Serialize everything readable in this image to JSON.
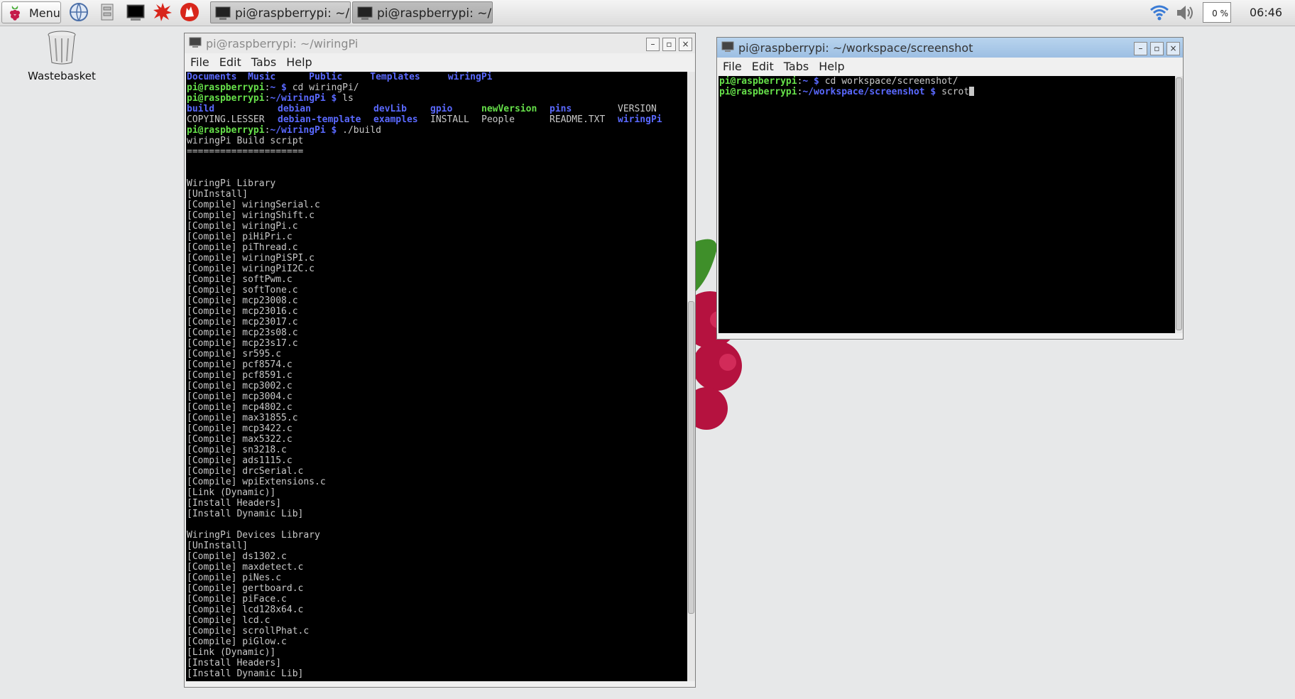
{
  "taskbar": {
    "menu_label": "Menu",
    "tasks": [
      {
        "label": "pi@raspberrypi: ~/wir..."
      },
      {
        "label": "pi@raspberrypi: ~/wo..."
      }
    ],
    "cpu": "0 %",
    "clock": "06:46"
  },
  "desktop": {
    "wastebasket_label": "Wastebasket"
  },
  "win1": {
    "title": "pi@raspberrypi: ~/wiringPi",
    "menu": [
      "File",
      "Edit",
      "Tabs",
      "Help"
    ],
    "dirs_line": "Documents  Music      Public     Templates     wiringPi",
    "prompt_user": "pi@raspberrypi",
    "cmd1_path": "~ $ ",
    "cmd1": "cd wiringPi/",
    "cmd2_path": "~/wiringPi $ ",
    "cmd2": "ls",
    "ls_row1": [
      "build",
      "debian",
      "devLib",
      "gpio",
      "newVersion",
      "pins",
      "VERSION"
    ],
    "ls_row2": [
      "COPYING.LESSER",
      "debian-template",
      "examples",
      "INSTALL",
      "People",
      "README.TXT",
      "wiringPi"
    ],
    "cmd3_path": "~/wiringPi $ ",
    "cmd3": "./build",
    "output": "wiringPi Build script\n=====================\n\n\nWiringPi Library\n[UnInstall]\n[Compile] wiringSerial.c\n[Compile] wiringShift.c\n[Compile] wiringPi.c\n[Compile] piHiPri.c\n[Compile] piThread.c\n[Compile] wiringPiSPI.c\n[Compile] wiringPiI2C.c\n[Compile] softPwm.c\n[Compile] softTone.c\n[Compile] mcp23008.c\n[Compile] mcp23016.c\n[Compile] mcp23017.c\n[Compile] mcp23s08.c\n[Compile] mcp23s17.c\n[Compile] sr595.c\n[Compile] pcf8574.c\n[Compile] pcf8591.c\n[Compile] mcp3002.c\n[Compile] mcp3004.c\n[Compile] mcp4802.c\n[Compile] max31855.c\n[Compile] mcp3422.c\n[Compile] max5322.c\n[Compile] sn3218.c\n[Compile] ads1115.c\n[Compile] drcSerial.c\n[Compile] wpiExtensions.c\n[Link (Dynamic)]\n[Install Headers]\n[Install Dynamic Lib]\n\nWiringPi Devices Library\n[UnInstall]\n[Compile] ds1302.c\n[Compile] maxdetect.c\n[Compile] piNes.c\n[Compile] gertboard.c\n[Compile] piFace.c\n[Compile] lcd128x64.c\n[Compile] lcd.c\n[Compile] scrollPhat.c\n[Compile] piGlow.c\n[Link (Dynamic)]\n[Install Headers]\n[Install Dynamic Lib]"
  },
  "win2": {
    "title": "pi@raspberrypi: ~/workspace/screenshot",
    "menu": [
      "File",
      "Edit",
      "Tabs",
      "Help"
    ],
    "prompt_user": "pi@raspberrypi",
    "cmd1_path": "~ $ ",
    "cmd1": "cd workspace/screenshot/",
    "cmd2_path": "~/workspace/screenshot $ ",
    "cmd2": "scrot"
  }
}
